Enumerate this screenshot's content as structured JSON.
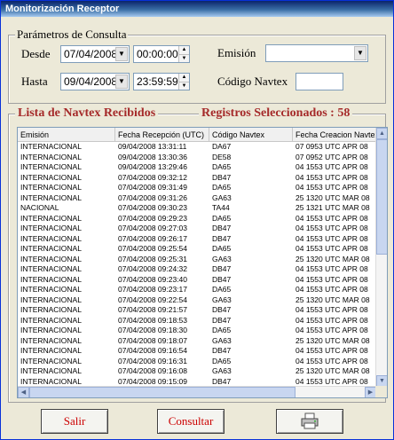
{
  "window": {
    "title": "Monitorización Receptor"
  },
  "params": {
    "group_title": "Parámetros de Consulta",
    "desde_label": "Desde",
    "hasta_label": "Hasta",
    "desde_date": "07/04/2008",
    "desde_time": "00:00:00",
    "hasta_date": "09/04/2008",
    "hasta_time": "23:59:59",
    "emision_label": "Emisión",
    "emision_value": "",
    "codigo_label": "Código Navtex",
    "codigo_value": ""
  },
  "list": {
    "title": "Lista de Navtex Recibidos",
    "registros": "Registros Seleccionados : 58",
    "columns": [
      "Emisión",
      "Fecha Recepción (UTC)",
      "Código Navtex",
      "Fecha Creacion Navtex"
    ],
    "rows": [
      [
        "INTERNACIONAL",
        "09/04/2008 13:31:11",
        "DA67",
        "07 0953 UTC APR 08"
      ],
      [
        "INTERNACIONAL",
        "09/04/2008 13:30:36",
        "DE58",
        "07 0952 UTC APR 08"
      ],
      [
        "INTERNACIONAL",
        "09/04/2008 13:29:46",
        "DA65",
        "04 1553 UTC APR 08"
      ],
      [
        "INTERNACIONAL",
        "07/04/2008 09:32:12",
        "DB47",
        "04 1553 UTC APR 08"
      ],
      [
        "INTERNACIONAL",
        "07/04/2008 09:31:49",
        "DA65",
        "04 1553 UTC APR 08"
      ],
      [
        "INTERNACIONAL",
        "07/04/2008 09:31:26",
        "GA63",
        "25 1320 UTC MAR 08"
      ],
      [
        "NACIONAL",
        "07/04/2008 09:30:23",
        "TA44",
        "25 1321 UTC MAR 08"
      ],
      [
        "INTERNACIONAL",
        "07/04/2008 09:29:23",
        "DA65",
        "04 1553 UTC APR 08"
      ],
      [
        "INTERNACIONAL",
        "07/04/2008 09:27:03",
        "DB47",
        "04 1553 UTC APR 08"
      ],
      [
        "INTERNACIONAL",
        "07/04/2008 09:26:17",
        "DB47",
        "04 1553 UTC APR 08"
      ],
      [
        "INTERNACIONAL",
        "07/04/2008 09:25:54",
        "DA65",
        "04 1553 UTC APR 08"
      ],
      [
        "INTERNACIONAL",
        "07/04/2008 09:25:31",
        "GA63",
        "25 1320 UTC MAR 08"
      ],
      [
        "INTERNACIONAL",
        "07/04/2008 09:24:32",
        "DB47",
        "04 1553 UTC APR 08"
      ],
      [
        "INTERNACIONAL",
        "07/04/2008 09:23:40",
        "DB47",
        "04 1553 UTC APR 08"
      ],
      [
        "INTERNACIONAL",
        "07/04/2008 09:23:17",
        "DA65",
        "04 1553 UTC APR 08"
      ],
      [
        "INTERNACIONAL",
        "07/04/2008 09:22:54",
        "GA63",
        "25 1320 UTC MAR 08"
      ],
      [
        "INTERNACIONAL",
        "07/04/2008 09:21:57",
        "DB47",
        "04 1553 UTC APR 08"
      ],
      [
        "INTERNACIONAL",
        "07/04/2008 09:18:53",
        "DB47",
        "04 1553 UTC APR 08"
      ],
      [
        "INTERNACIONAL",
        "07/04/2008 09:18:30",
        "DA65",
        "04 1553 UTC APR 08"
      ],
      [
        "INTERNACIONAL",
        "07/04/2008 09:18:07",
        "GA63",
        "25 1320 UTC MAR 08"
      ],
      [
        "INTERNACIONAL",
        "07/04/2008 09:16:54",
        "DB47",
        "04 1553 UTC APR 08"
      ],
      [
        "INTERNACIONAL",
        "07/04/2008 09:16:31",
        "DA65",
        "04 1553 UTC APR 08"
      ],
      [
        "INTERNACIONAL",
        "07/04/2008 09:16:08",
        "GA63",
        "25 1320 UTC MAR 08"
      ],
      [
        "INTERNACIONAL",
        "07/04/2008 09:15:09",
        "DB47",
        "04 1553 UTC APR 08"
      ]
    ]
  },
  "buttons": {
    "salir": "Salir",
    "consultar": "Consultar",
    "print_icon": "printer-icon"
  },
  "colors": {
    "accent_red": "#a52a2a",
    "button_text": "#cc0000"
  }
}
